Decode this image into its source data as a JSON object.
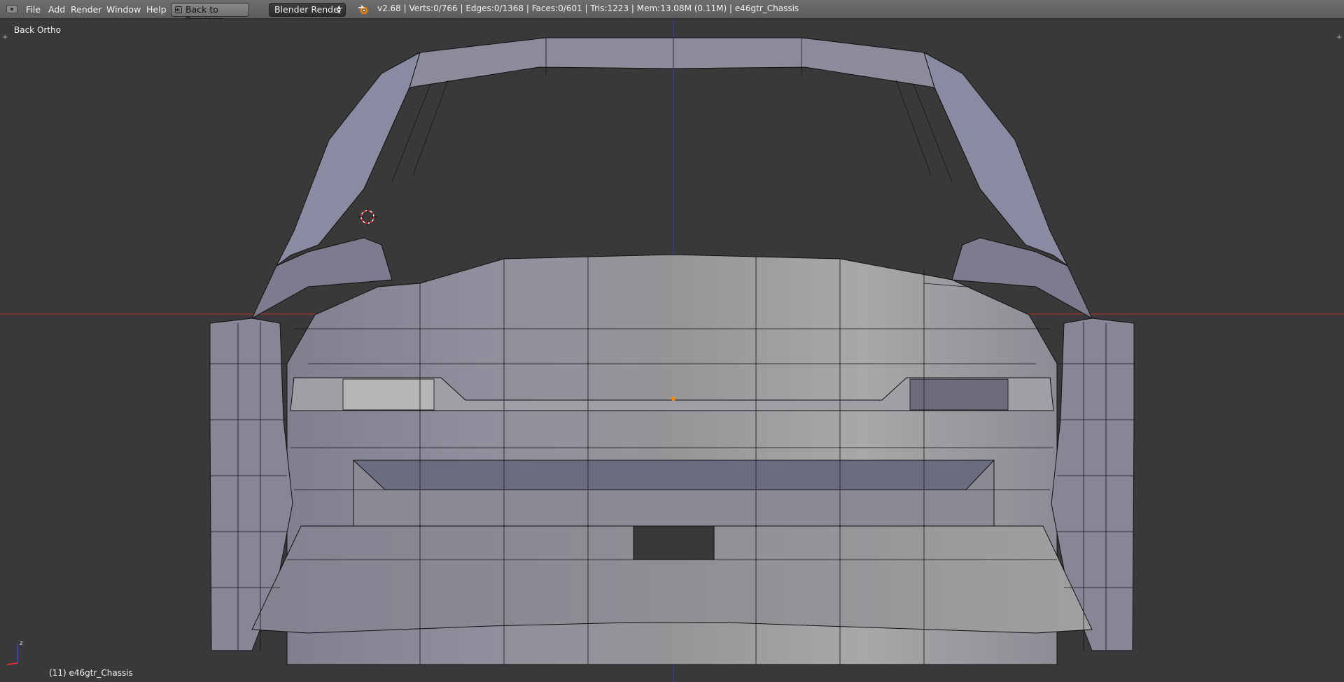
{
  "header": {
    "menu": {
      "file": "File",
      "add": "Add",
      "render": "Render",
      "window": "Window",
      "help": "Help"
    },
    "back_button": "Back to Previous",
    "render_engine": "Blender Render",
    "stats": "v2.68 | Verts:0/766 | Edges:0/1368 | Faces:0/601 | Tris:1223 | Mem:13.08M (0.11M) | e46gtr_Chassis"
  },
  "viewport": {
    "view_name": "Back Ortho",
    "object_info": "(11) e46gtr_Chassis"
  },
  "icons": {
    "editor_type": "editor-type-icon",
    "back": "back-arrow-icon",
    "engine": "blender-logo-icon",
    "cursor": "3d-cursor-icon",
    "axes": "axis-gizmo-icon"
  },
  "colors": {
    "background": "#393939",
    "header": "#646464",
    "mesh_fill": "#8e8e99",
    "mesh_edge": "#111111",
    "x_axis": "#a33131",
    "z_axis": "#3a3a9e",
    "selected_vertex": "#ff8c00"
  }
}
